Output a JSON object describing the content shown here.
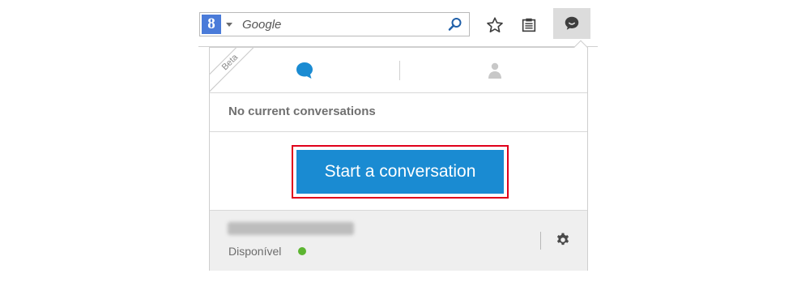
{
  "browser": {
    "search": {
      "engine_logo": "8",
      "placeholder": "Google",
      "icons": {
        "engine": "google-engine-icon",
        "dropdown": "caret-down-icon",
        "search": "magnifier-icon"
      }
    },
    "toolbar_icons": [
      "star-icon",
      "notepad-icon",
      "chat-bubble-icon"
    ]
  },
  "panel": {
    "beta_label": "Beta",
    "tabs": [
      {
        "name": "conversations",
        "icon": "chat-bubble-icon",
        "active": true
      },
      {
        "name": "contacts",
        "icon": "person-icon",
        "active": false
      }
    ],
    "empty_message": "No current conversations",
    "start_button_label": "Start a conversation",
    "footer": {
      "status_text": "Disponível",
      "status_color": "#5cb531",
      "settings_icon": "gear-icon"
    }
  },
  "colors": {
    "accent": "#1a8bd2",
    "highlight_border": "#e0001b"
  }
}
